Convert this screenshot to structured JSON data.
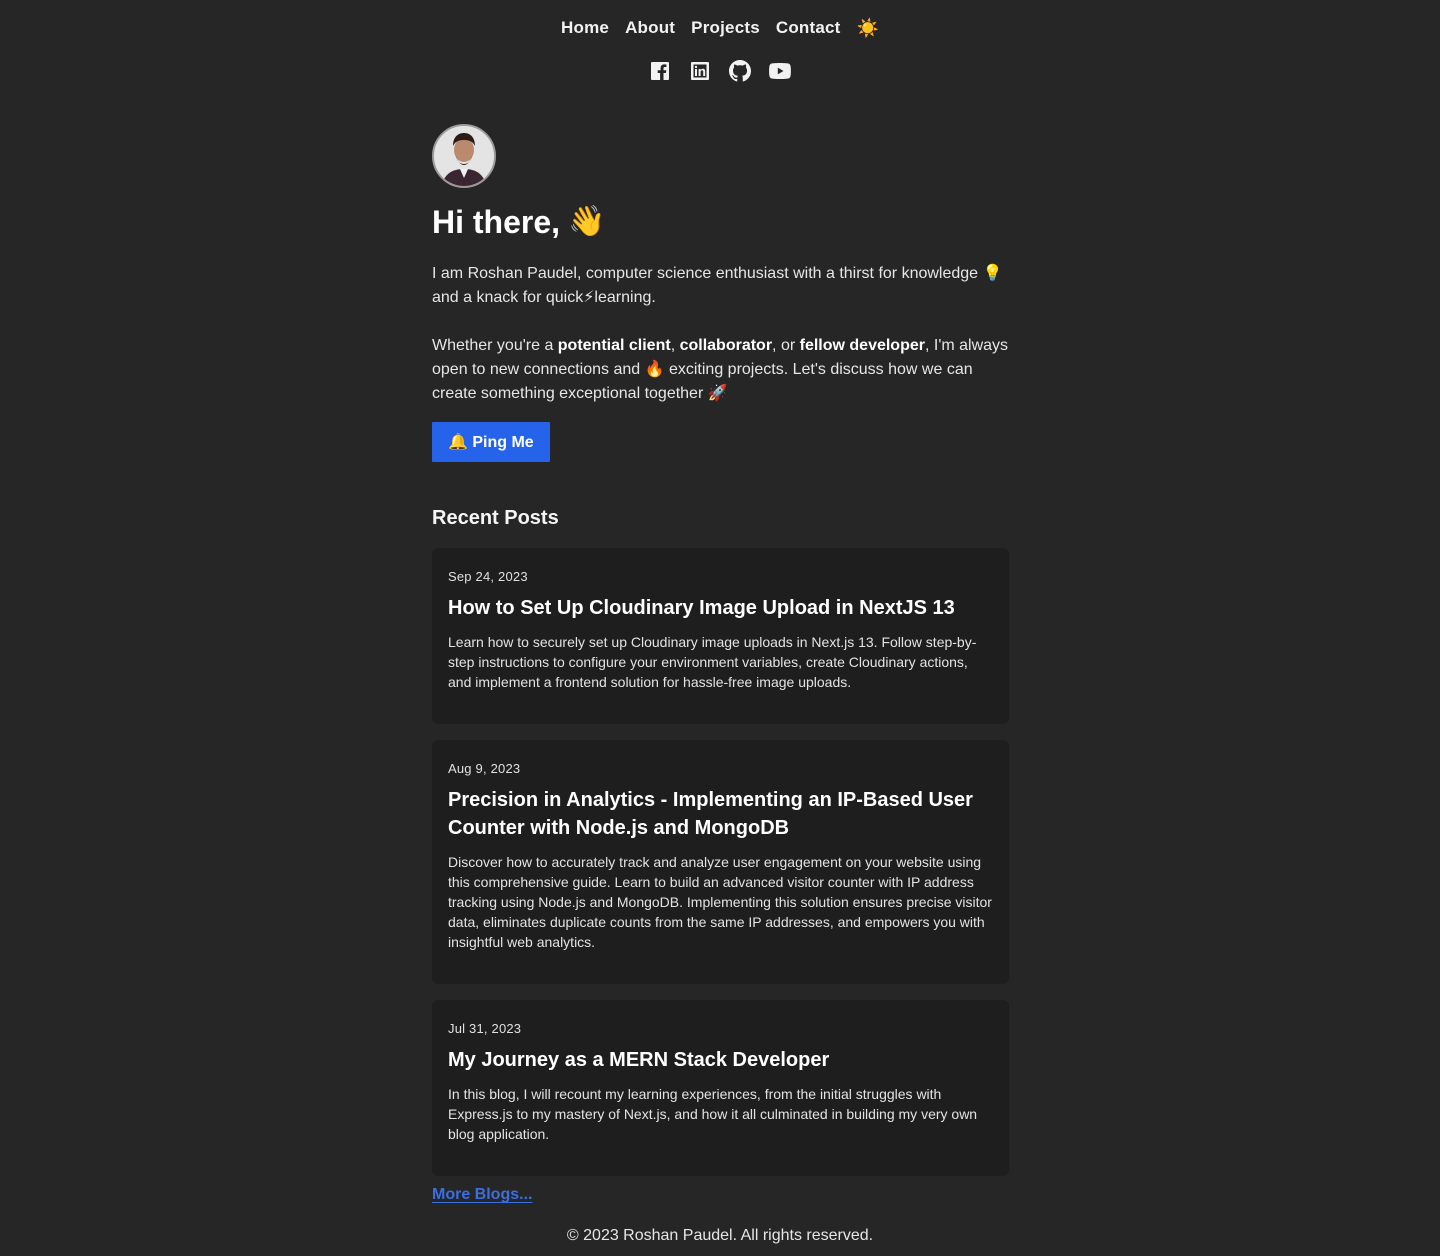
{
  "nav": {
    "items": [
      "Home",
      "About",
      "Projects",
      "Contact"
    ],
    "theme_icon": "☀️"
  },
  "socials": [
    "facebook-icon",
    "linkedin-icon",
    "github-icon",
    "youtube-icon"
  ],
  "hero": {
    "greeting": "Hi there,",
    "wave": "👋",
    "intro": "I am Roshan Paudel, computer science enthusiast with a thirst for knowledge 💡 and a knack for quick⚡learning.",
    "whether_prefix": "Whether you're a ",
    "role1": "potential client",
    "sep1": ", ",
    "role2": "collaborator",
    "sep2": ", or ",
    "role3": "fellow developer",
    "whether_suffix": ", I'm always open to new connections and 🔥 exciting projects. Let's discuss how we can create something exceptional together 🚀",
    "ping_label": "🔔 Ping Me"
  },
  "recent_posts": {
    "title": "Recent Posts",
    "posts": [
      {
        "date": "Sep 24, 2023",
        "title": "How to Set Up Cloudinary Image Upload in NextJS 13",
        "description": "Learn how to securely set up Cloudinary image uploads in Next.js 13. Follow step-by-step instructions to configure your environment variables, create Cloudinary actions, and implement a frontend solution for hassle-free image uploads."
      },
      {
        "date": "Aug 9, 2023",
        "title": "Precision in Analytics - Implementing an IP-Based User Counter with Node.js and MongoDB",
        "description": "Discover how to accurately track and analyze user engagement on your website using this comprehensive guide. Learn to build an advanced visitor counter with IP address tracking using Node.js and MongoDB. Implementing this solution ensures precise visitor data, eliminates duplicate counts from the same IP addresses, and empowers you with insightful web analytics."
      },
      {
        "date": "Jul 31, 2023",
        "title": "My Journey as a MERN Stack Developer",
        "description": "In this blog, I will recount my learning experiences, from the initial struggles with Express.js to my mastery of Next.js, and how it all culminated in building my very own blog application."
      }
    ],
    "more_label": "More Blogs..."
  },
  "footer": {
    "text": "© 2023 Roshan Paudel. All rights reserved."
  },
  "colors": {
    "background": "#262626",
    "card": "#1e1e1e",
    "accent": "#2563eb",
    "link": "#3b6ee0"
  }
}
